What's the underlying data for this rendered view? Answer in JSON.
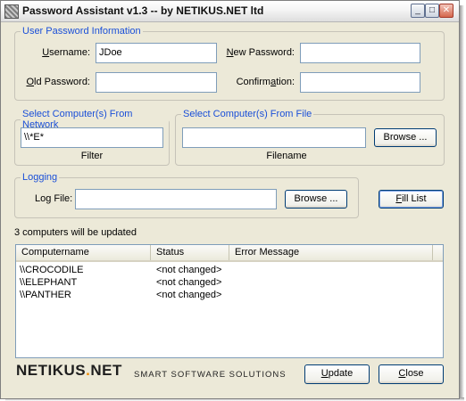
{
  "window": {
    "title": "Password Assistant v1.3 -- by NETIKUS.NET ltd",
    "controls": {
      "minimize": "_",
      "maximize": "□",
      "close": "✕"
    }
  },
  "user_info": {
    "legend": "User Password Information",
    "username_label": "Username:",
    "username_value": "JDoe",
    "old_password_label": "Old Password:",
    "old_password_value": "",
    "new_password_label": "New Password:",
    "new_password_value": "",
    "confirmation_label": "Confirmation:",
    "confirmation_value": ""
  },
  "network": {
    "legend": "Select Computer(s) From Network",
    "filter_value": "\\\\*E*",
    "filter_label": "Filter"
  },
  "file": {
    "legend": "Select Computer(s) From File",
    "filename_value": "",
    "browse_label": "Browse ...",
    "filename_label": "Filename"
  },
  "logging": {
    "legend": "Logging",
    "logfile_label": "Log File:",
    "logfile_value": "",
    "browse_label": "Browse ..."
  },
  "fill_list_label": "Fill List",
  "status_text": "3 computers will be updated",
  "table": {
    "columns": [
      "Computername",
      "Status",
      "Error Message"
    ],
    "rows": [
      {
        "computername": "\\\\CROCODILE",
        "status": "<not changed>",
        "error": ""
      },
      {
        "computername": "\\\\ELEPHANT",
        "status": "<not changed>",
        "error": ""
      },
      {
        "computername": "\\\\PANTHER",
        "status": "<not changed>",
        "error": ""
      }
    ]
  },
  "footer": {
    "brand_main": "NETIKUS",
    "brand_dot": ".",
    "brand_tld": "NET",
    "tagline": "SMART SOFTWARE SOLUTIONS",
    "update_label": "Update",
    "close_label": "Close"
  },
  "colors": {
    "group_legend": "#1a4fd8",
    "brand_dot": "#f08a00",
    "dialog_bg": "#ece9d8"
  }
}
